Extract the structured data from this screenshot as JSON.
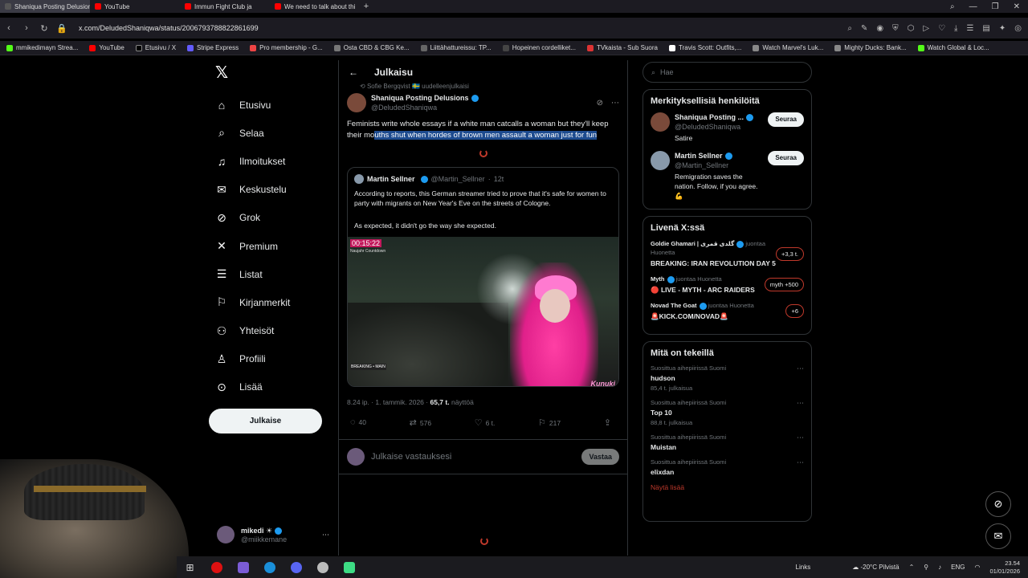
{
  "browser": {
    "tabs": [
      {
        "title": "Shaniqua Posting Delusions",
        "active": true,
        "color": "#555555"
      },
      {
        "title": "YouTube",
        "active": false,
        "color": "#ff0000"
      },
      {
        "title": "Immun Fight Club ja",
        "active": false,
        "color": "#ff0000"
      },
      {
        "title": "We need to talk about thi",
        "active": false,
        "color": "#ff0000"
      }
    ],
    "url": "x.com/DeludedShaniqwa/status/2006793788822861699",
    "bookmarks": [
      "mmikedimayn Strea...",
      "YouTube",
      "Etusivu / X",
      "Stripe Express",
      "Pro membership - G...",
      "Osta CBD & CBG Ke...",
      "Liittähattureissu: TP...",
      "Hopeinen cordelliket...",
      "TVkaista - Sub Suora",
      "Travis Scott: Outfits,...",
      "Watch Marvel's Luk...",
      "Mighty Ducks: Bank...",
      "Watch Global & Loc..."
    ]
  },
  "nav": {
    "items": [
      {
        "label": "Etusivu",
        "icon": "home-icon",
        "glyph": "⌂"
      },
      {
        "label": "Selaa",
        "icon": "search-icon",
        "glyph": "⌕"
      },
      {
        "label": "Ilmoitukset",
        "icon": "bell-icon",
        "glyph": "🔔"
      },
      {
        "label": "Keskustelu",
        "icon": "mail-icon",
        "glyph": "✉"
      },
      {
        "label": "Grok",
        "icon": "grok-icon",
        "glyph": "⊘"
      },
      {
        "label": "Premium",
        "icon": "x-icon",
        "glyph": "✕"
      },
      {
        "label": "Listat",
        "icon": "list-icon",
        "glyph": "☰"
      },
      {
        "label": "Kirjanmerkit",
        "icon": "bookmark-icon",
        "glyph": "⚑"
      },
      {
        "label": "Yhteisöt",
        "icon": "communities-icon",
        "glyph": "👥"
      },
      {
        "label": "Profiili",
        "icon": "profile-icon",
        "glyph": "👤"
      },
      {
        "label": "Lisää",
        "icon": "more-circle-icon",
        "glyph": "⋯"
      }
    ],
    "post_label": "Julkaise",
    "account_name": "mikedi",
    "account_handle": "@miikkemane"
  },
  "post": {
    "header": "Julkaisu",
    "repost_label": "Sofie Bergqvist 🇸🇪 uudelleenjulkaisi",
    "author_name": "Shaniqua Posting Delusions",
    "author_handle": "@DeludedShaniqwa",
    "text_plain": "Feminists write whole essays if a white man catcalls a woman but they'll keep their mo",
    "text_highlight": "uths shut when hordes of brown men assault a woman just for fun",
    "quote": {
      "author_name": "Martin Sellner",
      "author_handle": "@Martin_Sellner",
      "time": "12t",
      "text1": "According to reports, this German streamer tried to prove that it's safe for women to party with migrants on New Year's Eve on the streets of Cologne.",
      "text2": "As expected, it didn't go the way she expected.",
      "video_time": "00:15:22",
      "video_sub": "Naujahr Countdown",
      "video_logo": "Kunuki",
      "video_badge": "BREAKING • MAIN"
    },
    "meta_time": "8.24 ip. · 1. tammik. 2026 ·",
    "meta_views": "65,7 t.",
    "meta_views_label": "näyttöä",
    "replies": "40",
    "reposts": "576",
    "likes": "6 t.",
    "bookmarks": "217",
    "reply_placeholder": "Julkaise vastauksesi",
    "reply_button": "Vastaa"
  },
  "sidebar": {
    "search_placeholder": "Hae",
    "relevant_title": "Merkityksellisiä henkilöitä",
    "people": [
      {
        "name": "Shaniqua Posting ...",
        "handle": "@DeludedShaniqwa",
        "bio": "Satire",
        "follow": "Seuraa",
        "color": "#7a4a3a"
      },
      {
        "name": "Martin Sellner",
        "handle": "@Martin_Sellner",
        "bio": "Remigration saves the nation. Follow, if you agree. 💪",
        "follow": "Seuraa",
        "color": "#8899aa"
      }
    ],
    "live_title": "Livenä X:ssä",
    "live": [
      {
        "host": "Goldie Ghamari | گلدی قمری",
        "joined": "juontaa Huonetta",
        "title": "BREAKING: IRAN REVOLUTION DAY 5",
        "pill": "+3,3 t."
      },
      {
        "host": "Myth",
        "joined": "juontaa Huonetta",
        "title": "🔴 LIVE - MYTH - ARC RAIDERS",
        "pill": "myth +500"
      },
      {
        "host": "Novad The Goat",
        "joined": "juontaa Huonetta",
        "title": "🚨KICK.COM/NOVAD🚨",
        "pill": "+6"
      }
    ],
    "trends_title": "Mitä on tekeillä",
    "trends": [
      {
        "context": "Suosittua aihepiirissä Suomi",
        "name": "hudson",
        "count": "85,4 t. julkaisua"
      },
      {
        "context": "Suosittua aihepiirissä Suomi",
        "name": "Top 10",
        "count": "88,8 t. julkaisua"
      },
      {
        "context": "Suosittua aihepiirissä Suomi",
        "name": "Muistan",
        "count": ""
      },
      {
        "context": "Suosittua aihepiirissä Suomi",
        "name": "elixdan",
        "count": ""
      }
    ],
    "show_more": "Näytä lisää"
  },
  "taskbar": {
    "links": "Links",
    "weather": "-20°C Pilvistä",
    "lang": "ENG",
    "time": "23.54",
    "date": "01/01/2026"
  },
  "colors": {
    "accent": "#1d9bf0",
    "highlight": "#1d4b8f",
    "live_red": "#c0392b"
  }
}
